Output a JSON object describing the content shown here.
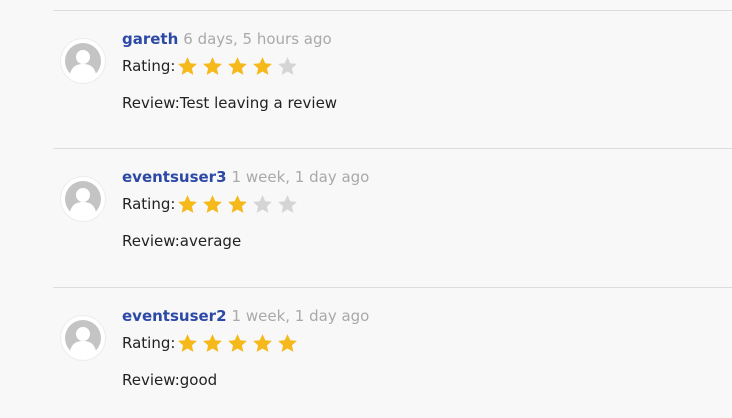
{
  "colors": {
    "username": "#2d49a6",
    "timestamp": "#a9a9a9",
    "star_filled": "#f6b91c",
    "star_empty": "#d5d5d5",
    "divider": "#dcdcdc",
    "background": "#f8f8f8"
  },
  "reviews": [
    {
      "username": "gareth",
      "time_ago": "6 days, 5 hours ago",
      "rating_label": "Rating:",
      "rating": 4,
      "max_rating": 5,
      "review_label": "Review:",
      "review_text": "Test leaving a review",
      "avatar_icon": "user-avatar-icon"
    },
    {
      "username": "eventsuser3",
      "time_ago": "1 week, 1 day ago",
      "rating_label": "Rating:",
      "rating": 3,
      "max_rating": 5,
      "review_label": "Review:",
      "review_text": "average",
      "avatar_icon": "user-avatar-icon"
    },
    {
      "username": "eventsuser2",
      "time_ago": "1 week, 1 day ago",
      "rating_label": "Rating:",
      "rating": 5,
      "max_rating": 5,
      "review_label": "Review:",
      "review_text": "good",
      "avatar_icon": "user-avatar-icon"
    }
  ]
}
